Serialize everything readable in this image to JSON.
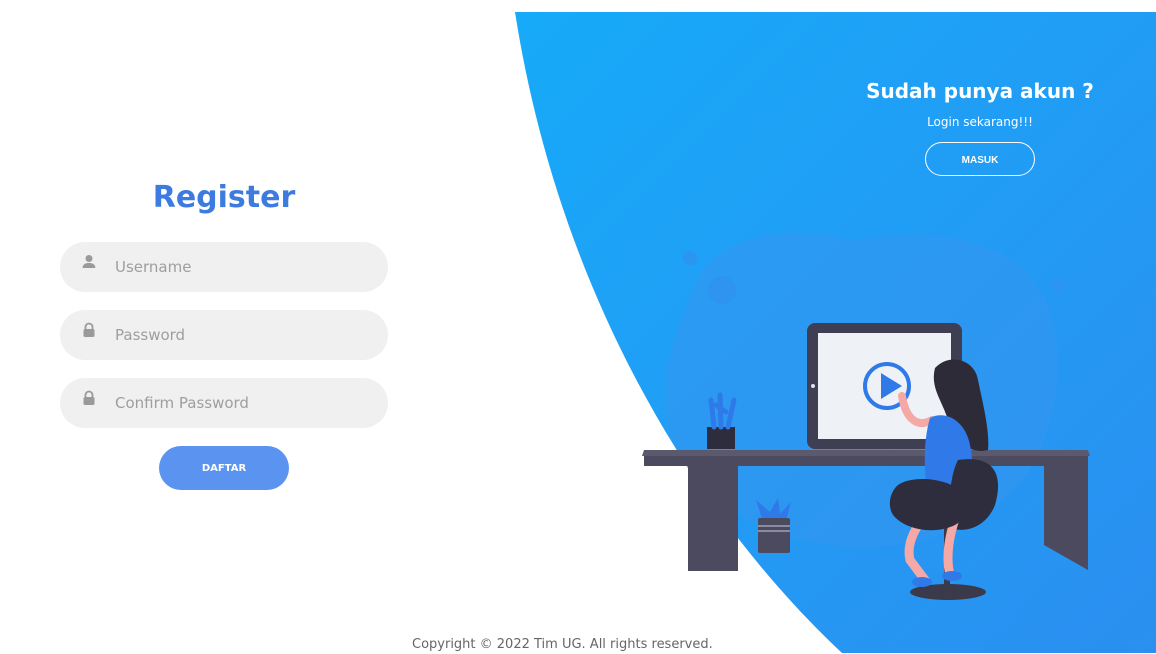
{
  "panel": {
    "title": "Sudah punya akun ?",
    "subtitle": "Login sekarang!!!",
    "login_button": "MASUK"
  },
  "form": {
    "title": "Register",
    "username_placeholder": "Username",
    "password_placeholder": "Password",
    "confirm_password_placeholder": "Confirm Password",
    "submit_label": "DAFTAR"
  },
  "footer": {
    "copyright": "Copyright © 2022 Tim UG. All rights reserved."
  },
  "colors": {
    "accent": "#3d7be0",
    "button": "#5b93f0",
    "panel_blue": "#1ea4f5"
  }
}
